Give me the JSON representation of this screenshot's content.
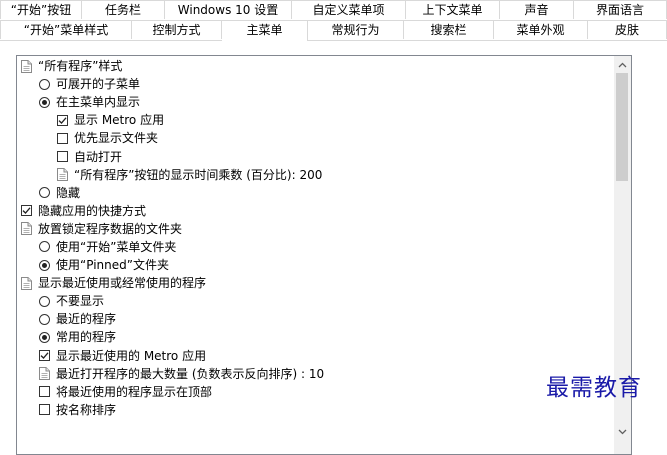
{
  "tabs": {
    "row1": [
      "“开始”按钮",
      "任务栏",
      "Windows 10 设置",
      "自定义菜单项",
      "上下文菜单",
      "声音",
      "界面语言"
    ],
    "row2": [
      "“开始”菜单样式",
      "控制方式",
      "主菜单",
      "常规行为",
      "搜索栏",
      "菜单外观",
      "皮肤"
    ],
    "active": "主菜单"
  },
  "tree": {
    "items": [
      {
        "label": "“所有程序”样式",
        "type": "doc",
        "level": 0
      },
      {
        "label": "可展开的子菜单",
        "type": "radio",
        "checked": false,
        "level": 1
      },
      {
        "label": "在主菜单内显示",
        "type": "radio",
        "checked": true,
        "level": 1
      },
      {
        "label": "显示 Metro 应用",
        "type": "checkbox",
        "checked": true,
        "level": 2
      },
      {
        "label": "优先显示文件夹",
        "type": "checkbox",
        "checked": false,
        "level": 2
      },
      {
        "label": "自动打开",
        "type": "checkbox",
        "checked": false,
        "level": 2
      },
      {
        "label": "“所有程序”按钮的显示时间乘数 (百分比): 200",
        "type": "doc",
        "level": 2
      },
      {
        "label": "隐藏",
        "type": "radio",
        "checked": false,
        "level": 1
      },
      {
        "label": "隐藏应用的快捷方式",
        "type": "checkbox",
        "checked": true,
        "level": 0
      },
      {
        "label": "放置锁定程序数据的文件夹",
        "type": "doc",
        "level": 0
      },
      {
        "label": "使用“开始”菜单文件夹",
        "type": "radio",
        "checked": false,
        "level": 1
      },
      {
        "label": "使用“Pinned”文件夹",
        "type": "radio",
        "checked": true,
        "level": 1
      },
      {
        "label": "显示最近使用或经常使用的程序",
        "type": "doc",
        "level": 0
      },
      {
        "label": "不要显示",
        "type": "radio",
        "checked": false,
        "level": 1
      },
      {
        "label": "最近的程序",
        "type": "radio",
        "checked": false,
        "level": 1
      },
      {
        "label": "常用的程序",
        "type": "radio",
        "checked": true,
        "level": 1
      },
      {
        "label": "显示最近使用的 Metro 应用",
        "type": "checkbox",
        "checked": true,
        "level": 1
      },
      {
        "label": "最近打开程序的最大数量 (负数表示反向排序) : 10",
        "type": "doc",
        "level": 1
      },
      {
        "label": "将最近使用的程序显示在顶部",
        "type": "checkbox",
        "checked": false,
        "level": 1
      },
      {
        "label": "按名称排序",
        "type": "checkbox",
        "checked": false,
        "level": 1
      }
    ]
  },
  "watermark": "最需教育"
}
